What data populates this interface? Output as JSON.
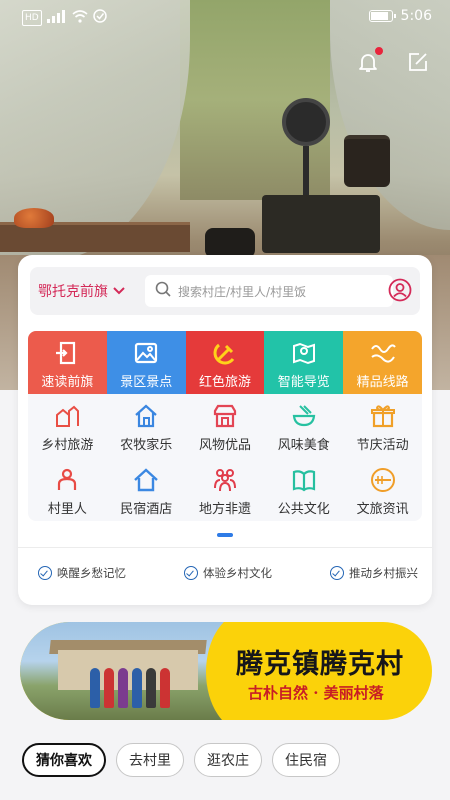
{
  "status_bar": {
    "left_icons": [
      "hd-icon",
      "signal-icon",
      "wifi-icon",
      "vpn-icon"
    ],
    "left_text": "HD",
    "time": "5:06",
    "battery_level": 0.9
  },
  "header": {
    "icons": [
      "bell-icon",
      "edit-icon"
    ],
    "notification_dot_color": "#e8243c"
  },
  "search": {
    "region": "鄂托克前旗",
    "placeholder": "搜索村庄/村里人/村里饭"
  },
  "grid": {
    "row1": [
      {
        "label": "速读前旗",
        "icon": "door-icon",
        "color": "#ec5b4c"
      },
      {
        "label": "景区景点",
        "icon": "picture-icon",
        "color": "#3e8fe6"
      },
      {
        "label": "红色旅游",
        "icon": "hammer-sickle-icon",
        "color": "#e53a3a"
      },
      {
        "label": "智能导览",
        "icon": "map-icon",
        "color": "#22c3a8"
      },
      {
        "label": "精品线路",
        "icon": "route-icon",
        "color": "#f4a52c"
      }
    ],
    "row2": [
      {
        "label": "乡村旅游",
        "icon": "village-icon",
        "color": "#e94f45"
      },
      {
        "label": "农牧家乐",
        "icon": "house-icon",
        "color": "#3a86e0"
      },
      {
        "label": "风物优品",
        "icon": "shop-icon",
        "color": "#e34554"
      },
      {
        "label": "风味美食",
        "icon": "bowl-icon",
        "color": "#27c1a1"
      },
      {
        "label": "节庆活动",
        "icon": "gift-icon",
        "color": "#f0a028"
      }
    ],
    "row3": [
      {
        "label": "村里人",
        "icon": "person-icon",
        "color": "#e84b45"
      },
      {
        "label": "民宿酒店",
        "icon": "home-icon",
        "color": "#3b88e2"
      },
      {
        "label": "地方非遗",
        "icon": "people-icon",
        "color": "#e13e4c"
      },
      {
        "label": "公共文化",
        "icon": "book-icon",
        "color": "#25bf9f"
      },
      {
        "label": "文旅资讯",
        "icon": "news-icon",
        "color": "#f09e29"
      }
    ]
  },
  "slogans": [
    "唤醒乡愁记忆",
    "体验乡村文化",
    "推动乡村振兴"
  ],
  "banner": {
    "title": "腾克镇腾克村",
    "subtitle": "古朴自然 · 美丽村落"
  },
  "tabs": [
    "猜你喜欢",
    "去村里",
    "逛农庄",
    "住民宿"
  ],
  "colors": {
    "accent": "#d42a58",
    "pager": "#2e7be6",
    "banner_bg": "#fbd20a"
  }
}
